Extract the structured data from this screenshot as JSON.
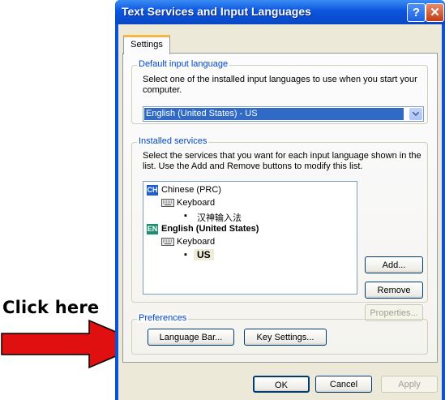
{
  "annotation": {
    "text": "Click here"
  },
  "window": {
    "title": "Text Services and Input Languages",
    "help_glyph": "?",
    "close_glyph": "✕"
  },
  "tabs": [
    {
      "label": "Settings"
    }
  ],
  "default_language": {
    "legend": "Default input language",
    "description": "Select one of the installed input languages to use when you start your computer.",
    "selected": "English (United States) - US"
  },
  "installed_services": {
    "legend": "Installed services",
    "description": "Select the services that you want for each input language shown in the list. Use the Add and Remove buttons to modify this list.",
    "languages": [
      {
        "badge": "CH",
        "badge_color": "#1c5fcf",
        "name": "Chinese (PRC)",
        "category": "Keyboard",
        "service": "汉神输入法"
      },
      {
        "badge": "EN",
        "badge_color": "#1a8f70",
        "name": "English (United States)",
        "category": "Keyboard",
        "service": "US"
      }
    ],
    "add_label": "Add...",
    "remove_label": "Remove",
    "properties_label": "Properties..."
  },
  "preferences": {
    "legend": "Preferences",
    "language_bar_label": "Language Bar...",
    "key_settings_label": "Key Settings..."
  },
  "footer": {
    "ok_label": "OK",
    "cancel_label": "Cancel",
    "apply_label": "Apply"
  },
  "colors": {
    "title_bar": "#0b55de",
    "selection": "#316ac5",
    "arrow": "#e01010",
    "legend": "#0046d5"
  }
}
